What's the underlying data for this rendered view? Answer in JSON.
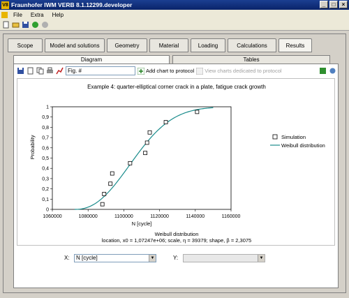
{
  "window": {
    "title": "Fraunhofer IWM VERB 8.1.12299.developer",
    "app_icon": "V8",
    "buttons": [
      "_",
      "□",
      "×"
    ]
  },
  "menu": {
    "items": [
      "File",
      "Extra",
      "Help"
    ]
  },
  "main_tabs": [
    "Scope",
    "Model and solutions",
    "Geometry",
    "Material",
    "Loading",
    "Calculations",
    "Results"
  ],
  "active_main_tab": "Results",
  "sub_tabs": [
    "Diagram",
    "Tables"
  ],
  "active_sub_tab": "Diagram",
  "chart_toolbar": {
    "figure_name": "Fig. #",
    "add_chart_label": "Add chart to protocol",
    "view_charts_label": "View charts dedicated to protocol"
  },
  "axis_selectors": {
    "x_label": "X:",
    "x_value": "N [cycle]",
    "y_label": "Y:",
    "y_value": ""
  },
  "chart_data": {
    "type": "scatter",
    "title": "Example 4: quarter-elliptical corner crack in a plate, fatigue crack growth",
    "xlabel": "N [cycle]",
    "ylabel": "Probability",
    "xlim": [
      1060000,
      1160000
    ],
    "ylim": [
      0,
      1
    ],
    "xticks": [
      1060000,
      1080000,
      1100000,
      1120000,
      1140000,
      1160000
    ],
    "yticks": [
      0,
      0.1,
      0.2,
      0.3,
      0.4,
      0.5,
      0.6,
      0.7,
      0.8,
      0.9,
      1
    ],
    "ytick_labels": [
      "0",
      "0,1",
      "0,2",
      "0,3",
      "0,4",
      "0,5",
      "0,6",
      "0,7",
      "0,8",
      "0,9",
      "1"
    ],
    "grid": false,
    "legend_position": "right",
    "series": [
      {
        "name": "Simulation",
        "type": "scatter",
        "marker": "square",
        "x": [
          1088000,
          1089000,
          1092500,
          1093500,
          1103500,
          1112000,
          1113000,
          1114500,
          1123500,
          1141000
        ],
        "y": [
          0.05,
          0.15,
          0.25,
          0.35,
          0.45,
          0.55,
          0.65,
          0.75,
          0.85,
          0.95
        ]
      },
      {
        "name": "Weibull distribution",
        "type": "line",
        "color": "#1a8c8c",
        "location": 1072470,
        "scale": 39379,
        "shape": 2.3075,
        "x_end": 1150000
      }
    ],
    "footer_title": "Weibull distribution",
    "footer_params": "location, x0 = 1,07247e+06; scale, η = 39379; shape, β = 2,3075"
  }
}
